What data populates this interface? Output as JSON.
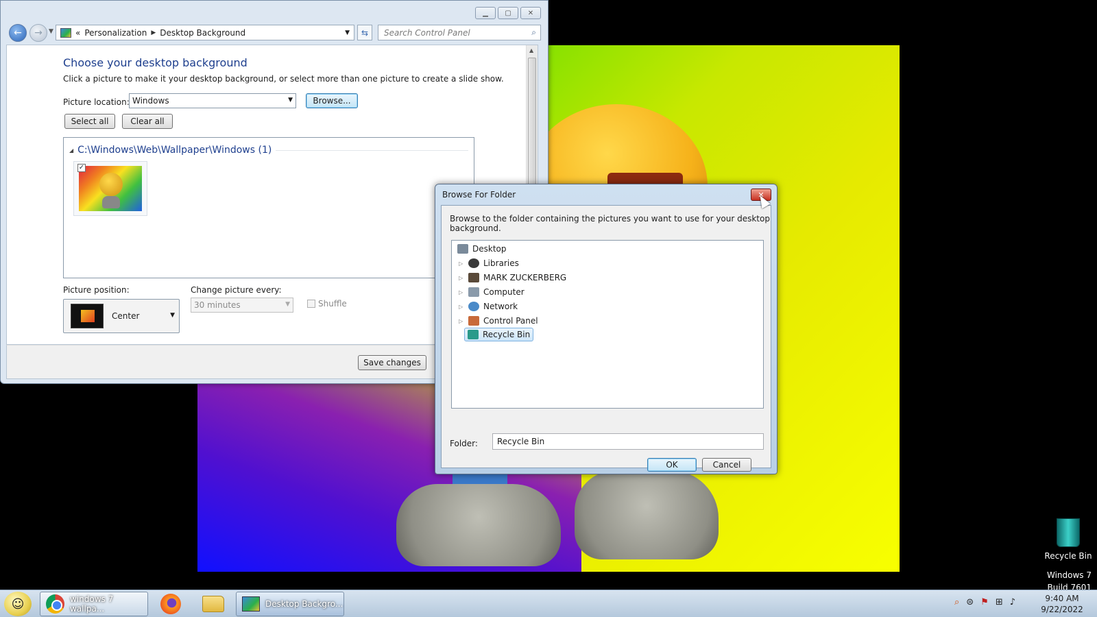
{
  "control_panel": {
    "breadcrumb": {
      "prefix": "«",
      "items": [
        "Personalization",
        "Desktop Background"
      ]
    },
    "search_placeholder": "Search Control Panel",
    "title": "Choose your desktop background",
    "subtitle": "Click a picture to make it your desktop background, or select more than one picture to create a slide show.",
    "picture_location_label": "Picture location:",
    "picture_location_value": "Windows",
    "browse_button": "Browse...",
    "select_all_button": "Select all",
    "clear_all_button": "Clear all",
    "folder_group": "C:\\Windows\\Web\\Wallpaper\\Windows (1)",
    "thumbnail_checked": "✓",
    "picture_position_label": "Picture position:",
    "picture_position_value": "Center",
    "change_every_label": "Change picture every:",
    "change_every_value": "30 minutes",
    "shuffle_label": "Shuffle",
    "save_button": "Save changes"
  },
  "browse_dialog": {
    "title": "Browse For Folder",
    "close_glyph": "✕",
    "description": "Browse to the folder containing the pictures you want to use for your desktop background.",
    "tree": [
      {
        "label": "Desktop",
        "icon": "desktop-icon",
        "color": "#7a8a9a"
      },
      {
        "label": "Libraries",
        "icon": "libraries-icon",
        "color": "#3a3a3a"
      },
      {
        "label": "MARK ZUCKERBERG",
        "icon": "user-icon",
        "color": "#5a4a3a"
      },
      {
        "label": "Computer",
        "icon": "computer-icon",
        "color": "#8a9aaa"
      },
      {
        "label": "Network",
        "icon": "network-icon",
        "color": "#4a8ac8"
      },
      {
        "label": "Control Panel",
        "icon": "control-panel-icon",
        "color": "#c86a3a"
      },
      {
        "label": "Recycle Bin",
        "icon": "recycle-bin-icon",
        "color": "#2a9a8a"
      }
    ],
    "folder_label": "Folder:",
    "folder_value": "Recycle Bin",
    "ok_button": "OK",
    "cancel_button": "Cancel"
  },
  "desktop": {
    "recycle_bin_label": "Recycle Bin",
    "watermark_line1": "Windows 7",
    "watermark_line2": "Build 7601"
  },
  "taskbar": {
    "chrome_button": "windows 7 wallpa...",
    "control_panel_button": "Desktop Backgro...",
    "time": "9:40 AM",
    "date": "9/22/2022"
  }
}
